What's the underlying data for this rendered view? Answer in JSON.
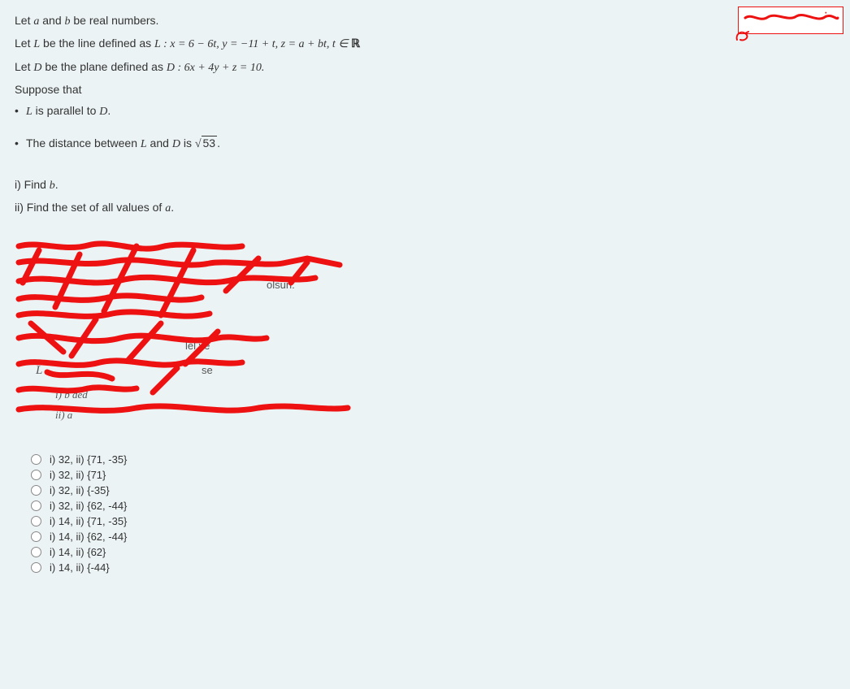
{
  "question": {
    "l1_prefix": "Let ",
    "l1_a": "a",
    "l1_mid": " and ",
    "l1_b": "b",
    "l1_suffix": " be real numbers.",
    "l2_prefix": "Let ",
    "l2_L": "L",
    "l2_mid": " be the line defined as  ",
    "l2_eq": "L : x = 6 − 6t,  y = −11 + t,  z = a + bt,  t ∈ ",
    "l2_R": "ℝ",
    "l3_prefix": "Let ",
    "l3_D": "D",
    "l3_mid": " be the plane defined as ",
    "l3_eq": "D : 6x + 4y + z = 10.",
    "suppose": "Suppose that",
    "bul1_pre": "",
    "bul1_L": "L",
    "bul1_mid": " is parallel to ",
    "bul1_D": "D",
    "bul1_end": ".",
    "bul2_pre": "The distance between ",
    "bul2_L": "L",
    "bul2_mid": " and ",
    "bul2_D": "D",
    "bul2_is": " is ",
    "bul2_sqrt": "53",
    "bul2_end": ".",
    "i_pre": "i) Find ",
    "i_b": "b",
    "i_end": ".",
    "ii_pre": "ii) Find the set of all values of ",
    "ii_a": "a",
    "ii_end": "."
  },
  "scribble": {
    "t1": "olsun:",
    "t2": "lel ve",
    "t3": "se",
    "t4": "i) b ded",
    "t5": "ii) a",
    "tL": "L"
  },
  "options": [
    "i) 32,  ii) {71, -35}",
    "i) 32,  ii) {71}",
    "i) 32,  ii) {-35}",
    "i) 32,  ii) {62, -44}",
    "i) 14,  ii) {71, -35}",
    "i) 14,  ii) {62, -44}",
    "i) 14,  ii) {62}",
    "i) 14,  ii) {-44}"
  ]
}
